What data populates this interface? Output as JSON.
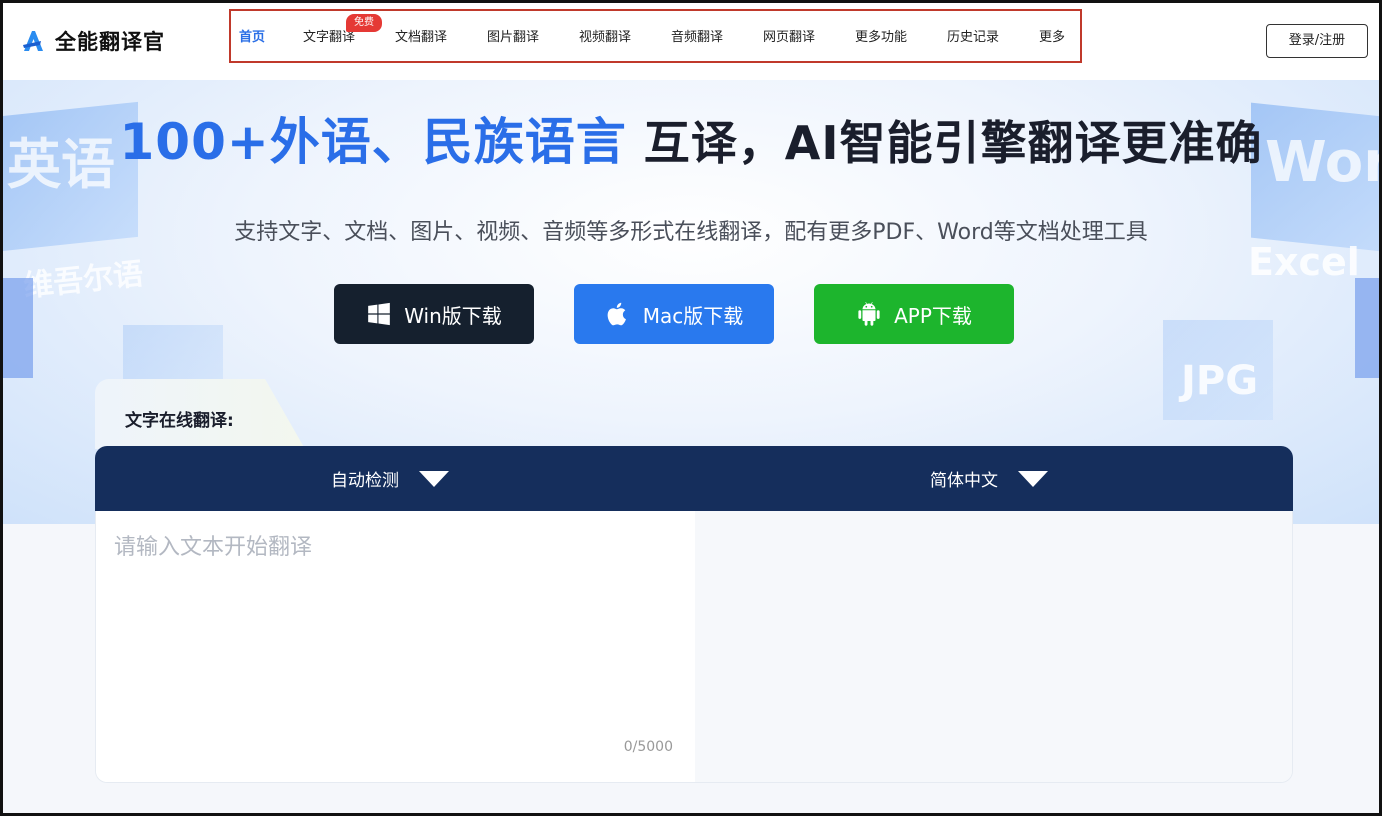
{
  "brand": {
    "name": "全能翻译官"
  },
  "nav": {
    "items": [
      {
        "label": "首页",
        "active": true
      },
      {
        "label": "文字翻译"
      },
      {
        "label": "文档翻译"
      },
      {
        "label": "图片翻译"
      },
      {
        "label": "视频翻译"
      },
      {
        "label": "音频翻译"
      },
      {
        "label": "网页翻译"
      },
      {
        "label": "更多功能"
      },
      {
        "label": "历史记录"
      },
      {
        "label": "更多"
      }
    ],
    "badge": "免费"
  },
  "auth": {
    "login_label": "登录/注册"
  },
  "hero": {
    "title_part1": "100+外语、民族语言",
    "title_part2": " 互译，AI智能引擎翻译更准确",
    "subtitle": "支持文字、文档、图片、视频、音频等多形式在线翻译，配有更多PDF、Word等文档处理工具",
    "buttons": {
      "win": "Win版下载",
      "mac": "Mac版下载",
      "app": "APP下载"
    },
    "decor": {
      "left_big": "英语",
      "left_small": "维吾尔语",
      "right_word": "Word",
      "right_excel": "Excel",
      "right_jpg": "JPG"
    }
  },
  "translator": {
    "tab_label": "文字在线翻译:",
    "source_lang": "自动检测",
    "target_lang": "简体中文",
    "placeholder": "请输入文本开始翻译",
    "counter": "0/5000"
  },
  "colors": {
    "accent": "#2a6ee8",
    "nav_highlight_border": "#c0392b",
    "lang_bar": "#152e5c",
    "win_btn": "#15202e",
    "mac_btn": "#2979ee",
    "app_btn": "#1db52d",
    "badge": "#e53935"
  }
}
